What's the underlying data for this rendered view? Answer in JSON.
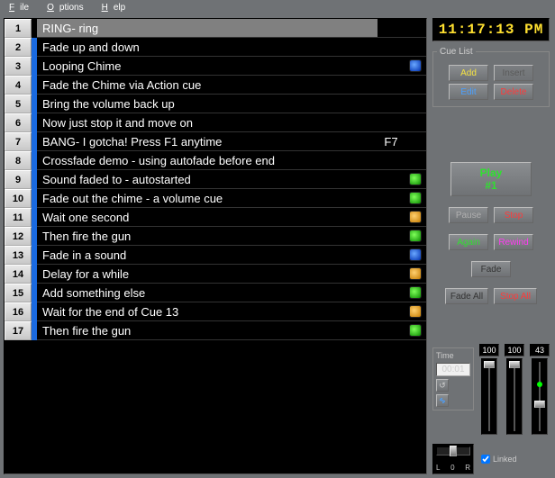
{
  "menu": {
    "file": "File",
    "options": "Options",
    "help": "Help"
  },
  "clock": "11:17:13 PM",
  "cuelist_legend": "Cue List",
  "buttons": {
    "add": "Add",
    "insert": "Insert",
    "edit": "Edit",
    "delete": "Delete",
    "play_line1": "Play",
    "play_line2": "#1",
    "pause": "Pause",
    "stop": "Stop",
    "again": "Again",
    "rewind": "Rewind",
    "fade": "Fade",
    "fadeall": "Fade All",
    "stopall": "Stop All"
  },
  "time": {
    "label": "Time",
    "value": "00:01"
  },
  "faders": {
    "vals": [
      "100",
      "100",
      "43"
    ],
    "linked": "Linked",
    "lr": {
      "l": "L",
      "c": "0",
      "r": "R"
    }
  },
  "cues": [
    {
      "num": "1",
      "desc": "RING- ring",
      "stripe": "none",
      "icon": "",
      "hot": "",
      "sel": true
    },
    {
      "num": "2",
      "desc": "Fade up and down",
      "stripe": "blue",
      "icon": "",
      "hot": ""
    },
    {
      "num": "3",
      "desc": "Looping Chime",
      "stripe": "blue",
      "icon": "blue",
      "hot": ""
    },
    {
      "num": "4",
      "desc": "Fade the Chime via Action cue",
      "stripe": "blue",
      "icon": "",
      "hot": ""
    },
    {
      "num": "5",
      "desc": "Bring the volume back up",
      "stripe": "blue",
      "icon": "",
      "hot": ""
    },
    {
      "num": "6",
      "desc": "Now just stop it and move on",
      "stripe": "blue",
      "icon": "",
      "hot": ""
    },
    {
      "num": "7",
      "desc": "BANG- I gotcha! Press F1 anytime",
      "stripe": "blue",
      "icon": "",
      "hot": "F7"
    },
    {
      "num": "8",
      "desc": "Crossfade demo  - using autofade before end",
      "stripe": "blue",
      "icon": "",
      "hot": ""
    },
    {
      "num": "9",
      "desc": "Sound faded to - autostarted",
      "stripe": "blue",
      "icon": "green",
      "hot": ""
    },
    {
      "num": "10",
      "desc": "Fade out the chime - a volume cue",
      "stripe": "blue",
      "icon": "green",
      "hot": ""
    },
    {
      "num": "11",
      "desc": "Wait one second",
      "stripe": "blue",
      "icon": "orange",
      "hot": ""
    },
    {
      "num": "12",
      "desc": "Then fire the gun",
      "stripe": "blue",
      "icon": "green",
      "hot": ""
    },
    {
      "num": "13",
      "desc": "Fade in a sound",
      "stripe": "blue",
      "icon": "blue",
      "hot": ""
    },
    {
      "num": "14",
      "desc": "Delay for a while",
      "stripe": "blue",
      "icon": "orange",
      "hot": ""
    },
    {
      "num": "15",
      "desc": "Add something else",
      "stripe": "blue",
      "icon": "green",
      "hot": ""
    },
    {
      "num": "16",
      "desc": "Wait for the end of Cue 13",
      "stripe": "blue",
      "icon": "orange",
      "hot": ""
    },
    {
      "num": "17",
      "desc": "Then fire the gun",
      "stripe": "blue",
      "icon": "green",
      "hot": ""
    }
  ]
}
